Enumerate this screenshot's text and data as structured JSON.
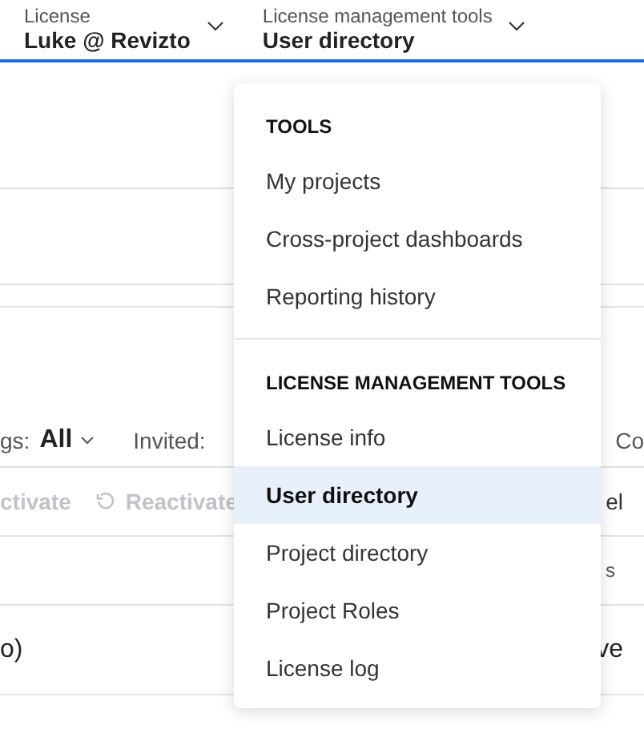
{
  "header": {
    "selectors": [
      {
        "label": "License",
        "value": "Luke @ Revizto"
      },
      {
        "label": "License management tools",
        "value": "User directory"
      }
    ]
  },
  "filters": [
    {
      "label": "gs:",
      "value": "All"
    },
    {
      "label": "Invited:"
    },
    {
      "label": "Co"
    }
  ],
  "toolbar": [
    {
      "label": "ctivate",
      "disabled": true,
      "kind": "text"
    },
    {
      "label": "Reactivate",
      "disabled": true,
      "kind": "reload"
    },
    {
      "label": "el",
      "disabled": false,
      "kind": "text"
    }
  ],
  "table": {
    "header": {
      "column_1": "s"
    },
    "rows": [
      {
        "column_1": "o)",
        "column_2": "ve"
      }
    ]
  },
  "menu": {
    "sections": [
      {
        "title": "TOOLS",
        "items": [
          {
            "label": "My projects",
            "selected": false
          },
          {
            "label": "Cross-project dashboards",
            "selected": false
          },
          {
            "label": "Reporting history",
            "selected": false
          }
        ]
      },
      {
        "title": "LICENSE MANAGEMENT TOOLS",
        "items": [
          {
            "label": "License info",
            "selected": false
          },
          {
            "label": "User directory",
            "selected": true
          },
          {
            "label": "Project directory",
            "selected": false
          },
          {
            "label": "Project Roles",
            "selected": false
          },
          {
            "label": "License log",
            "selected": false
          }
        ]
      }
    ]
  }
}
